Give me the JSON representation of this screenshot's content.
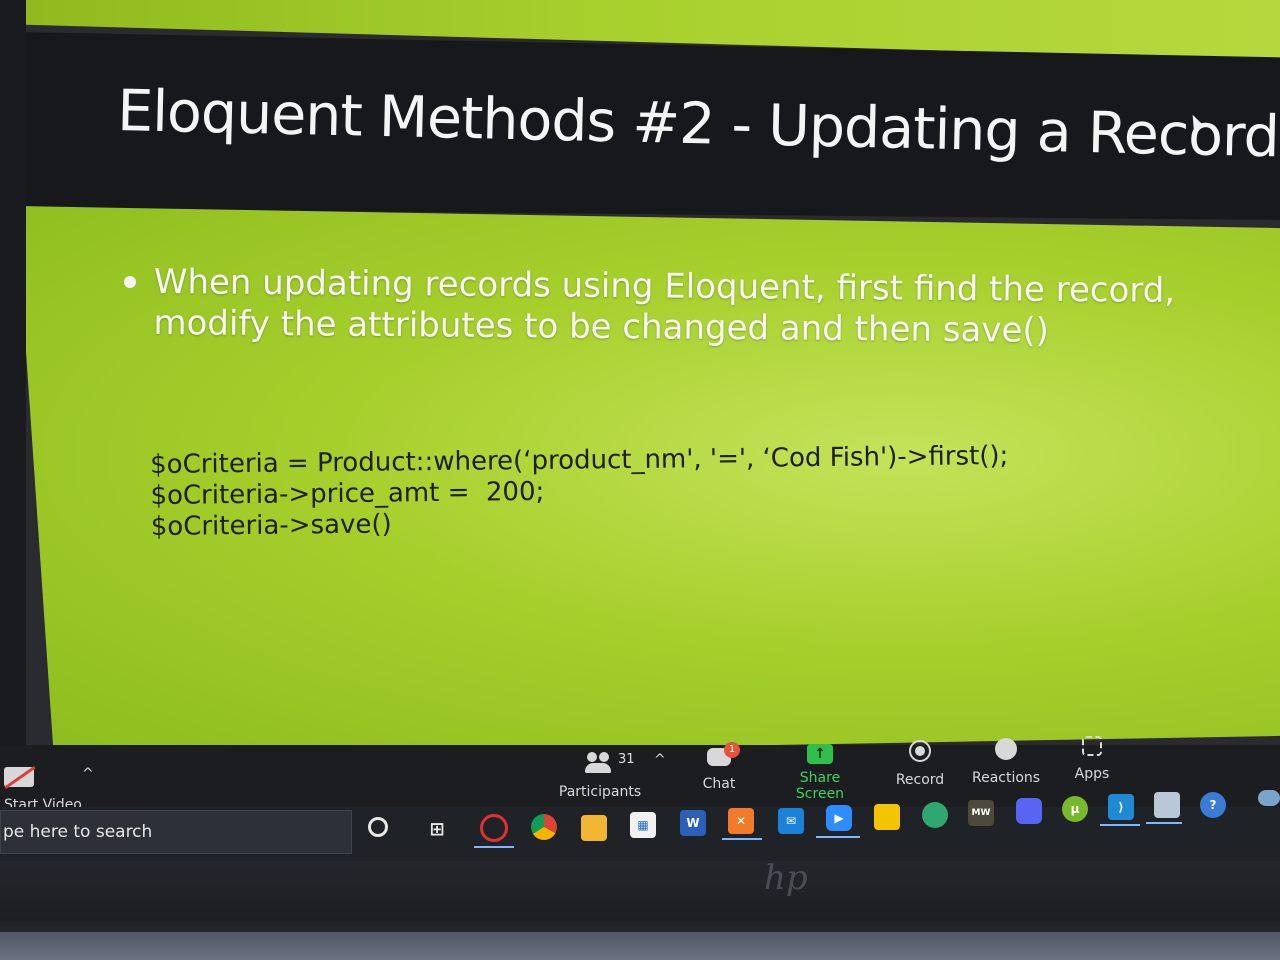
{
  "slide": {
    "title": "Eloquent Methods #2 - Updating a Record",
    "bullet": "When updating records using Eloquent, first find the record, modify the attributes to be changed and then save()",
    "code_lines": [
      "$oCriteria = Product::where(‘product_nm', '=', ‘Cod Fish')->first();",
      "$oCriteria->price_amt =  200;",
      "$oCriteria->save()"
    ]
  },
  "zoom_toolbar": {
    "start_video": "Start Video",
    "participants": "Participants",
    "participants_count": "31",
    "chat": "Chat",
    "chat_badge": "1",
    "share_screen": "Share Screen",
    "record": "Record",
    "reactions": "Reactions",
    "apps": "Apps"
  },
  "taskbar": {
    "search_placeholder": "pe here to search",
    "icons": [
      "search-circle-icon",
      "task-view-icon",
      "opera-icon",
      "chrome-icon",
      "file-explorer-icon",
      "store-icon",
      "word-icon",
      "xampp-icon",
      "mail-icon",
      "zoom-icon",
      "sticky-notes-icon",
      "spotify-icon",
      "mw-icon",
      "discord-icon",
      "utorrent-icon",
      "vscode-icon",
      "notepad-icon",
      "help-icon",
      "cloud-icon"
    ]
  },
  "device": {
    "brand": "hp"
  },
  "colors": {
    "slide_green": "#a7cf2c",
    "title_bar": "#16181c",
    "share_green": "#3fd45a",
    "badge_red": "#e5533d"
  }
}
